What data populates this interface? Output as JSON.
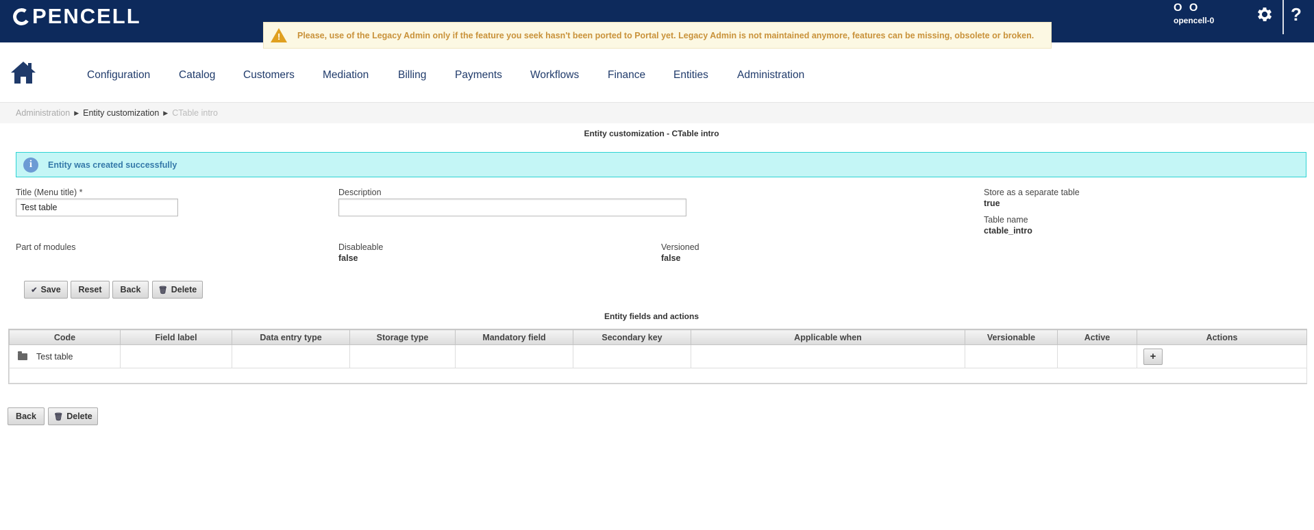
{
  "app": {
    "logo": "PENCELL"
  },
  "warning": {
    "text": "Please, use of the Legacy Admin only if the feature you seek hasn't been ported to Portal yet. Legacy Admin is not maintained anymore, features can be missing, obsolete or broken."
  },
  "user": {
    "initials": "O O",
    "name": "opencell-0"
  },
  "header_icons": {
    "settings": "gear-icon",
    "help": "?"
  },
  "menu": [
    {
      "label": "Configuration"
    },
    {
      "label": "Catalog"
    },
    {
      "label": "Customers"
    },
    {
      "label": "Mediation"
    },
    {
      "label": "Billing"
    },
    {
      "label": "Payments"
    },
    {
      "label": "Workflows"
    },
    {
      "label": "Finance"
    },
    {
      "label": "Entities"
    },
    {
      "label": "Administration"
    }
  ],
  "breadcrumb": [
    "Administration",
    "Entity customization",
    "CTable intro"
  ],
  "page_title": "Entity customization - CTable intro",
  "info_message": "Entity was created successfully",
  "form": {
    "title_label": "Title (Menu title) *",
    "title_value": "Test table",
    "description_label": "Description",
    "description_value": "",
    "store_label": "Store as a separate table",
    "store_value": "true",
    "table_name_label": "Table name",
    "table_name_value": "ctable_intro",
    "modules_label": "Part of modules",
    "disableable_label": "Disableable",
    "disableable_value": "false",
    "versioned_label": "Versioned",
    "versioned_value": "false"
  },
  "buttons": {
    "save": "Save",
    "reset": "Reset",
    "back": "Back",
    "delete": "Delete"
  },
  "fields_section": {
    "title": "Entity fields and actions",
    "columns": [
      "Code",
      "Field label",
      "Data entry type",
      "Storage type",
      "Mandatory field",
      "Secondary key",
      "Applicable when",
      "Versionable",
      "Active",
      "Actions"
    ],
    "rows": [
      {
        "code": "Test table",
        "action": "+"
      }
    ]
  },
  "colors": {
    "header_bg": "#0d2a5c",
    "info_bg": "#c4f6f6",
    "warning_text": "#c9923a"
  }
}
